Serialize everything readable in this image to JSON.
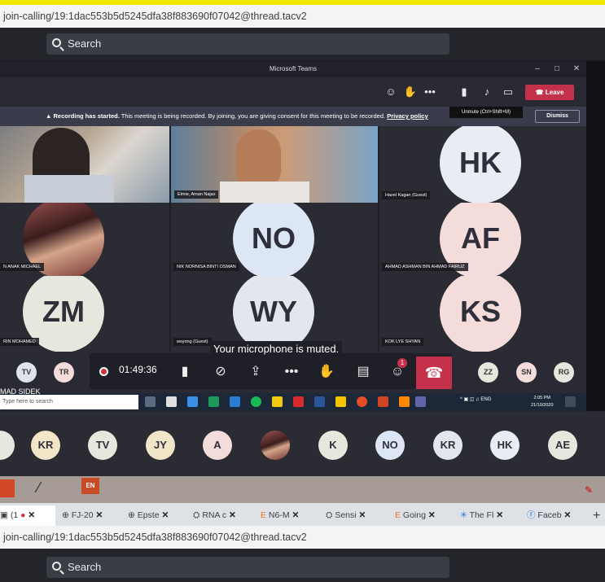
{
  "browser": {
    "url": "join-calling/19:1dac553b5d5245dfa38f883690f07042@thread.tacv2",
    "url_bottom": "join-calling/19:1dac553b5d5245dfa38f883690f07042@thread.tacv2",
    "search_placeholder": "Search",
    "search_placeholder_bottom": "Search"
  },
  "teams": {
    "window_title": "Microsoft Teams",
    "leave_label": "Leave",
    "tooltip": "Unmute (Ctrl+Shift+M)",
    "recording_bold": "Recording has started.",
    "recording_text": " This meeting is being recorded. By joining, you are giving consent for this meeting to be recorded.",
    "privacy_policy": "Privacy policy",
    "dismiss": "Dismiss",
    "tiles": [
      {
        "initials": "",
        "name": ""
      },
      {
        "initials": "",
        "name": "Elmie, Aman Najas"
      },
      {
        "initials": "HK",
        "name": "Hazel Kagan (Guest)",
        "color": "#e9ecf5"
      },
      {
        "initials": "",
        "name": "N ANAK MICHAEL"
      },
      {
        "initials": "NO",
        "name": "NIK NORNISA BINTI OSMAN",
        "color": "#dde6f4"
      },
      {
        "initials": "AF",
        "name": "AHMAD ASHMAN BIN AHMAD FAIRUZ",
        "color": "#f3dcd9"
      },
      {
        "initials": "ZM",
        "name": "RIN MOHAMED",
        "color": "#e5e8dc"
      },
      {
        "initials": "WY",
        "name": "wsyong (Guest)",
        "color": "#e3e6ec"
      },
      {
        "initials": "KS",
        "name": "KOK LYE SHYAN",
        "color": "#f3dcd9"
      }
    ],
    "timer": "01:49:36",
    "muted_message": "Your microphone is muted.",
    "raise_count": "1",
    "bottom_avatars_left": [
      "TV",
      "TR"
    ],
    "bottom_avatars_right": [
      "ZZ",
      "SN",
      "RG"
    ]
  },
  "taskbar": {
    "user_label": "MAD SIDEK",
    "search_placeholder": "Type here to search",
    "lang": "ENG",
    "time": "2:05 PM",
    "date": "21/10/2020"
  },
  "strip": {
    "avatars": [
      "KR",
      "TV",
      "JY",
      "A",
      "",
      "K",
      "NO",
      "KR",
      "HK",
      "AE"
    ]
  },
  "tabs": [
    {
      "label": "(1"
    },
    {
      "label": "FJ-20"
    },
    {
      "label": "Epste"
    },
    {
      "label": "RNA c"
    },
    {
      "label": "N6-M"
    },
    {
      "label": "Sensi"
    },
    {
      "label": "Going"
    },
    {
      "label": "The Fl"
    },
    {
      "label": "Faceb"
    }
  ],
  "desktop": {
    "en_label": "EN"
  },
  "colors": {
    "leave": "#c4314b",
    "accent": "#6264a7",
    "hangup": "#c4314b"
  }
}
